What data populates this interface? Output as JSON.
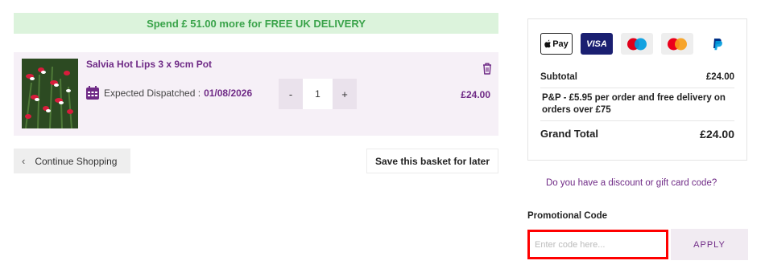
{
  "banner": {
    "text": "Spend £ 51.00 more for FREE UK DELIVERY"
  },
  "item": {
    "name": "Salvia Hot Lips 3 x 9cm Pot",
    "dispatch_label": "Expected Dispatched :",
    "dispatch_date": "01/08/2026",
    "qty_minus": "-",
    "qty_plus": "+",
    "quantity": "1",
    "price": "£24.00"
  },
  "actions": {
    "continue_label": "Continue Shopping",
    "save_label": "Save this basket for later"
  },
  "summary": {
    "payment_methods": [
      {
        "name": "Apple Pay",
        "label": "Pay",
        "icon": "apple-pay-icon"
      },
      {
        "name": "Visa",
        "label": "VISA",
        "icon": "visa-icon"
      },
      {
        "name": "Maestro",
        "icon": "maestro-icon"
      },
      {
        "name": "Mastercard",
        "icon": "mastercard-icon"
      },
      {
        "name": "PayPal",
        "icon": "paypal-icon"
      }
    ],
    "subtotal_label": "Subtotal",
    "subtotal_value": "£24.00",
    "pnp_text": "P&P - £5.95 per order and free delivery on orders over £75",
    "grand_total_label": "Grand Total",
    "grand_total_value": "£24.00"
  },
  "discount": {
    "link_text": "Do you have a discount or gift card code?"
  },
  "promo": {
    "label": "Promotional Code",
    "placeholder": "Enter code here...",
    "value": "",
    "apply_label": "APPLY"
  },
  "colors": {
    "brand_purple": "#6f2a86",
    "banner_green": "#3aa34a",
    "banner_bg": "#dcf3dc",
    "highlight_red": "#ff0000"
  }
}
